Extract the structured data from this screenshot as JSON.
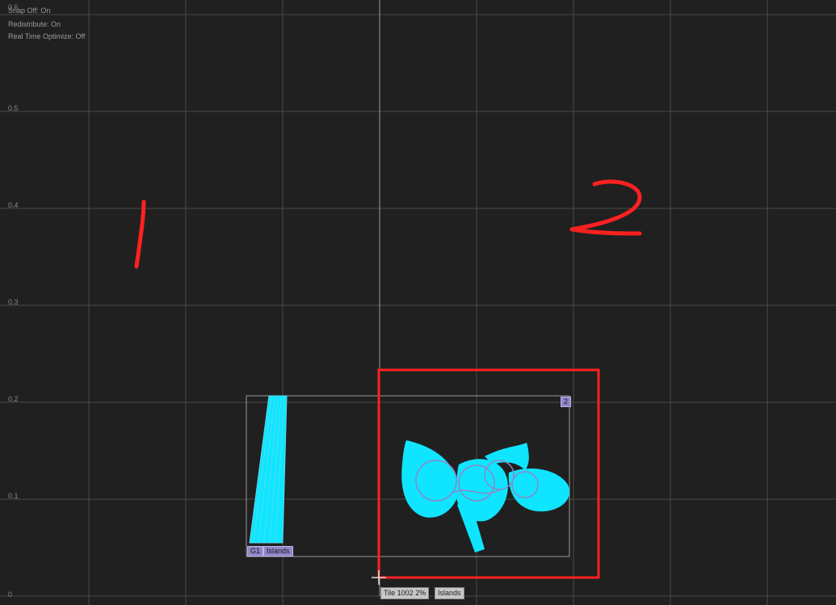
{
  "viewport": {
    "overlay_lines": [
      "Snap Off: On",
      "Redistribute: On",
      "Real Time Optimize: Off"
    ],
    "axis_labels": {
      "top": "0.6",
      "v05": "0.5",
      "v04": "0.4",
      "v03": "0.3",
      "v02": "0.2",
      "v01": "0.1",
      "v00": "0"
    }
  },
  "islands": {
    "group1": {
      "badge": "G1",
      "label": "Islands"
    },
    "group2": {
      "badge": "2"
    }
  },
  "cursor_tooltip": {
    "tile": "Tile 1002 2%",
    "label": "Islands"
  },
  "annotations": {
    "number_one": "1",
    "number_two": "2"
  },
  "colors": {
    "background": "#202020",
    "grid": "#4a4a4a",
    "uv_fill": "#0fe5ff",
    "uv_edge": "#8e86c9",
    "highlight": "#ff2020"
  }
}
